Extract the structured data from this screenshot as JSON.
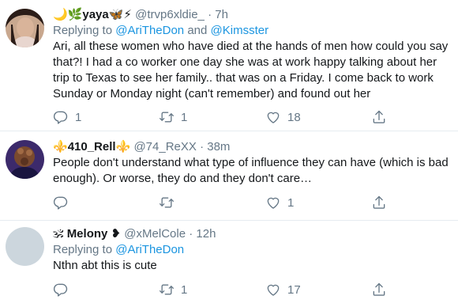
{
  "tweets": [
    {
      "name": "yaya",
      "name_prefix": "🌙🌿",
      "name_suffix": "🦋⚡",
      "handle": "@trvp6xldie_",
      "sep": "·",
      "time": "7h",
      "reply_label": "Replying to",
      "reply_to": "@AriTheDon",
      "reply_and": "and",
      "reply_to2": "@Kimsster",
      "text": "Ari, all these women who have died at the hands of men how could you say that?! I had a co worker one day she was at work happy talking about her trip to Texas to see her family.. that was on a Friday. I come back to work Sunday or Monday night (can't remember) and found out her",
      "replies": "1",
      "retweets": "1",
      "likes": "18"
    },
    {
      "name": "410_Rell",
      "name_prefix": "⚜️",
      "name_suffix": "⚜️",
      "handle": "@74_ReXX",
      "sep": "·",
      "time": "38m",
      "text": "People don't understand what type of influence they can have (which is bad enough). Or worse, they do and they don't care…",
      "replies": "",
      "retweets": "",
      "likes": "1"
    },
    {
      "name": "Melony",
      "name_prefix": "🕉",
      "name_suffix": "❥",
      "handle": "@xMelCole",
      "sep": "·",
      "time": "12h",
      "reply_label": "Replying to",
      "reply_to": "@AriTheDon",
      "text": "Nthn abt this is cute",
      "replies": "",
      "retweets": "1",
      "likes": "17"
    }
  ],
  "icons": {
    "reply": "reply-icon",
    "retweet": "retweet-icon",
    "like": "like-icon",
    "share": "share-icon"
  },
  "colors": {
    "mention": "#1b95e0",
    "secondary": "#657786",
    "divider": "#e6ecf0"
  }
}
